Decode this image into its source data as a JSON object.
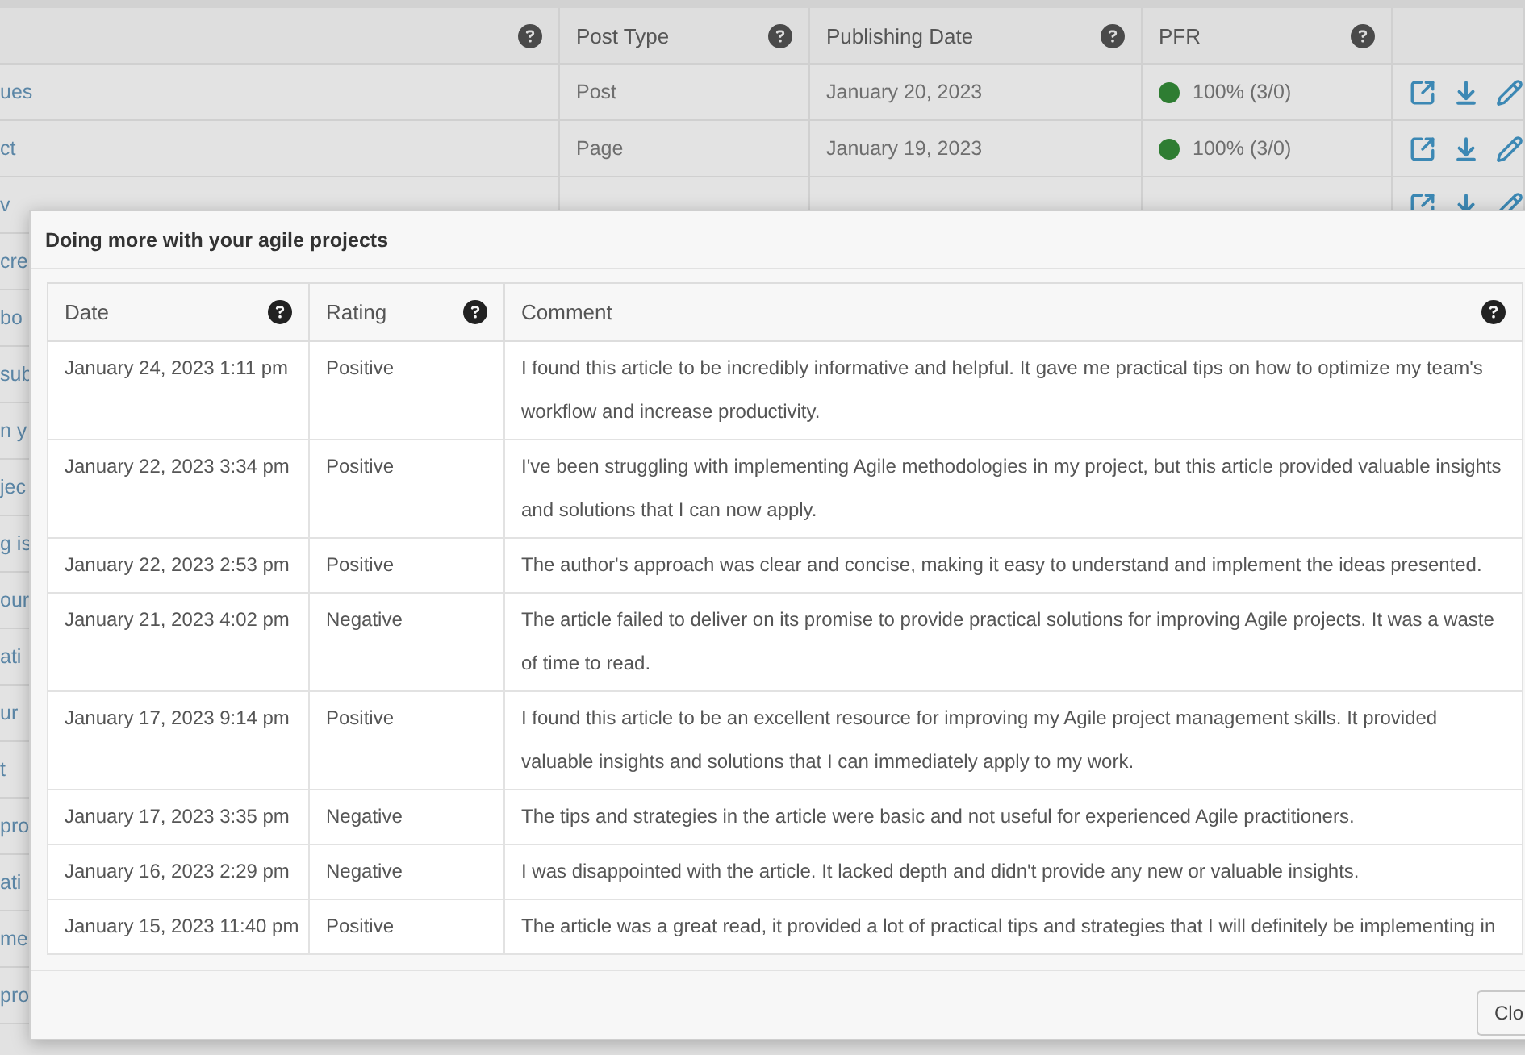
{
  "background_table": {
    "columns": [
      {
        "help": true
      },
      {
        "label": "Post Type",
        "help": true
      },
      {
        "label": "Publishing Date",
        "help": true
      },
      {
        "label": "PFR",
        "help": true
      },
      {
        "help": false
      }
    ],
    "rows": [
      {
        "title": "ues",
        "post_type": "Post",
        "date": "January 20, 2023",
        "pfr": {
          "text": "100% (3/0)",
          "color": "#2e7d32"
        },
        "actions": true
      },
      {
        "title": "ct",
        "post_type": "Page",
        "date": "January 19, 2023",
        "pfr": {
          "text": "100% (3/0)",
          "color": "#2e7d32"
        },
        "actions": true
      },
      {
        "title": "v",
        "actions": true
      },
      {
        "title": "cre"
      },
      {
        "title": "bo"
      },
      {
        "title": "sub"
      },
      {
        "title": "n y"
      },
      {
        "title": "jec"
      },
      {
        "title": "g is"
      },
      {
        "title": "our"
      },
      {
        "title": "ati"
      },
      {
        "title": "ur"
      },
      {
        "title": "t"
      },
      {
        "title": "pro"
      },
      {
        "title": "ati"
      },
      {
        "title": "me"
      },
      {
        "title": "pro"
      }
    ]
  },
  "modal": {
    "title": "Doing more with your agile projects",
    "columns": [
      {
        "label": "Date",
        "help": true
      },
      {
        "label": "Rating",
        "help": true
      },
      {
        "label": "Comment",
        "help": true
      }
    ],
    "rows": [
      {
        "date": "January 24, 2023 1:11 pm",
        "rating": "Positive",
        "comment": "I found this article to be incredibly informative and helpful. It gave me practical tips on how to optimize my team's workflow and increase productivity."
      },
      {
        "date": "January 22, 2023 3:34 pm",
        "rating": "Positive",
        "comment": "I've been struggling with implementing Agile methodologies in my project, but this article provided valuable insights and solutions that I can now apply."
      },
      {
        "date": "January 22, 2023 2:53 pm",
        "rating": "Positive",
        "comment": "The author's approach was clear and concise, making it easy to understand and implement the ideas presented."
      },
      {
        "date": "January 21, 2023 4:02 pm",
        "rating": "Negative",
        "comment": "The article failed to deliver on its promise to provide practical solutions for improving Agile projects. It was a waste of time to read."
      },
      {
        "date": "January 17, 2023 9:14 pm",
        "rating": "Positive",
        "comment": "I found this article to be an excellent resource for improving my Agile project management skills. It provided valuable insights and solutions that I can immediately apply to my work."
      },
      {
        "date": "January 17, 2023 3:35 pm",
        "rating": "Negative",
        "comment": "The tips and strategies in the article were basic and not useful for experienced Agile practitioners."
      },
      {
        "date": "January 16, 2023 2:29 pm",
        "rating": "Negative",
        "comment": "I was disappointed with the article. It lacked depth and didn't provide any new or valuable insights."
      },
      {
        "date": "January 15, 2023 11:40 pm",
        "rating": "Positive",
        "comment": "The article was a great read, it provided a lot of practical tips and strategies that I will definitely be implementing in"
      }
    ],
    "close_label": "Clo"
  }
}
